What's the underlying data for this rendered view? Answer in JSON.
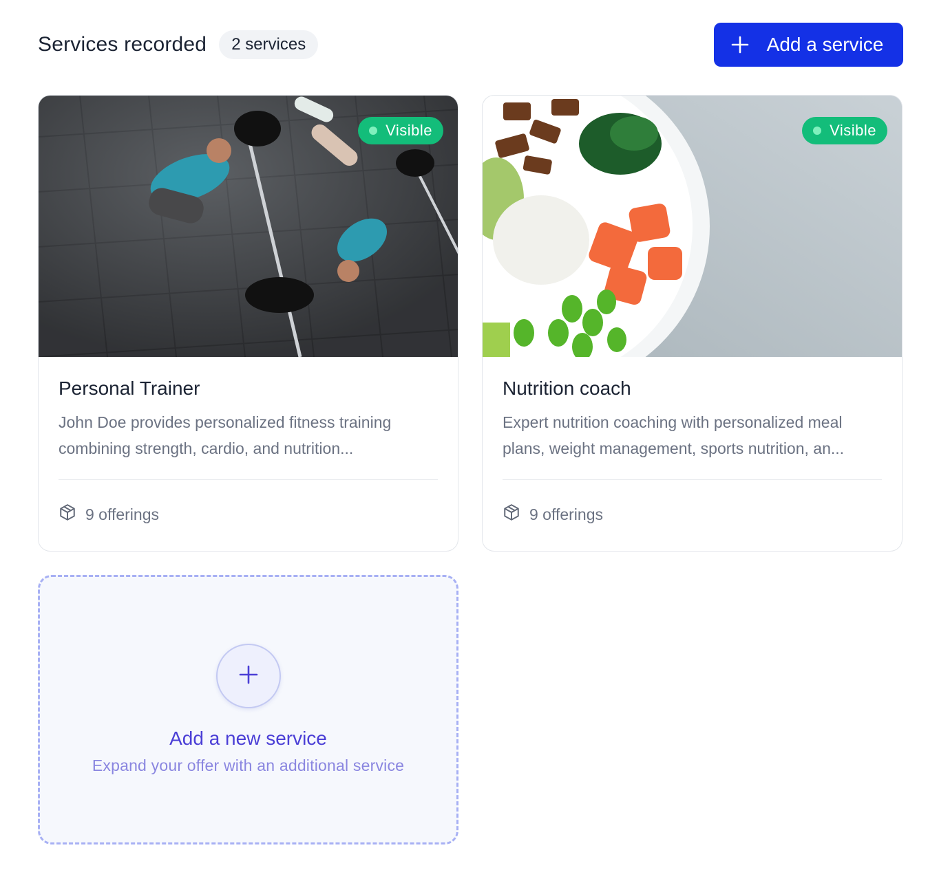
{
  "header": {
    "title": "Services recorded",
    "count_badge": "2 services",
    "add_button_label": "Add a service"
  },
  "services": [
    {
      "title": "Personal Trainer",
      "description": "John Doe provides personalized fitness training combining strength, cardio, and nutrition...",
      "status": "Visible",
      "offerings": "9 offerings",
      "image": "gym-workout-photo"
    },
    {
      "title": "Nutrition coach",
      "description": "Expert nutrition coaching with personalized meal plans, weight management, sports nutrition, an...",
      "status": "Visible",
      "offerings": "9 offerings",
      "image": "healthy-bowl-photo"
    }
  ],
  "add_card": {
    "title": "Add a new service",
    "subtitle": "Expand your offer with an additional service"
  },
  "colors": {
    "primary": "#1431e6",
    "visible_badge": "#13bd7a",
    "add_card_accent": "#4b3fd6",
    "dashed_border": "#a7b0f4"
  },
  "icons": {
    "plus": "plus-icon",
    "offerings": "package-icon"
  }
}
